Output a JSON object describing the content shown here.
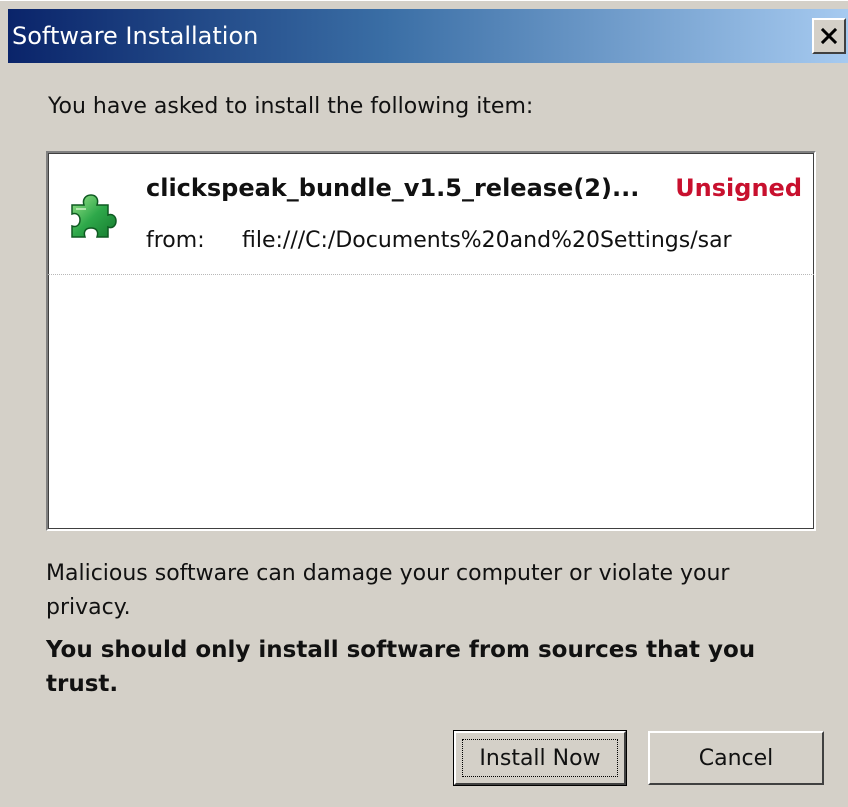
{
  "window": {
    "title": "Software Installation",
    "close_label": "×"
  },
  "intro": "You have asked to install the following item:",
  "item": {
    "name": "clickspeak_bundle_v1.5_release(2)...",
    "status": "Unsigned",
    "from_label": "from:",
    "from_url": "file:///C:/Documents%20and%20Settings/sar",
    "icon": "puzzle-piece-icon"
  },
  "warning": "Malicious software can damage your computer or violate your privacy.",
  "trust_notice": "You should only install software from sources that you trust.",
  "buttons": {
    "install": "Install Now",
    "cancel": "Cancel"
  },
  "colors": {
    "title_gradient_start": "#0a246a",
    "title_gradient_end": "#a6caf0",
    "status_red": "#c8102e",
    "dialog_bg": "#d4d0c8",
    "icon_green": "#2ea84a"
  }
}
